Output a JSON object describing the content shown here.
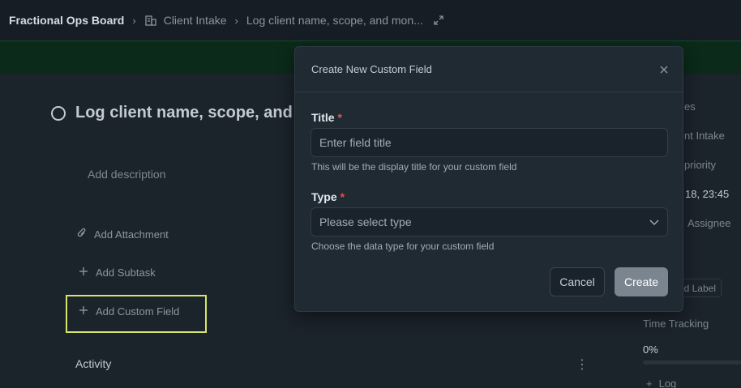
{
  "breadcrumb": {
    "root": "Fractional Ops Board",
    "section": "Client Intake",
    "task": "Log client name, scope, and mon..."
  },
  "task": {
    "title": "Log client name, scope, and m",
    "add_description": "Add description",
    "add_attachment": "Add Attachment",
    "add_subtask": "Add Subtask",
    "add_custom_field": "Add Custom Field",
    "activity": "Activity"
  },
  "sidebar": {
    "item1": "es",
    "item2": "nt Intake",
    "item3": "priority",
    "date": "18, 23:45",
    "assignee": "Assignee",
    "label": "d Label",
    "time_tracking": "Time Tracking",
    "progress_text": "0%",
    "progress": 0,
    "log": "Log"
  },
  "modal": {
    "title": "Create New Custom Field",
    "title_label": "Title",
    "required_mark": "*",
    "title_placeholder": "Enter field title",
    "title_helper": "This will be the display title for your custom field",
    "type_label": "Type",
    "type_placeholder": "Please select type",
    "type_helper": "Choose the data type for your custom field",
    "cancel": "Cancel",
    "create": "Create"
  },
  "colors": {
    "background": "#1b232b",
    "topbar": "#161d24",
    "banner": "#0b2a1a",
    "modal": "#1f2a33",
    "highlight": "#d7e36a",
    "required": "#e5534b",
    "create_button": "#7b8590"
  },
  "icons": {
    "board": "building-icon",
    "expand": "expand-icon",
    "close": "close-icon",
    "attachment": "paperclip-icon",
    "add": "plus-icon",
    "chevron": "chevron-down-icon",
    "status": "circle-icon",
    "more": "kebab-icon"
  }
}
